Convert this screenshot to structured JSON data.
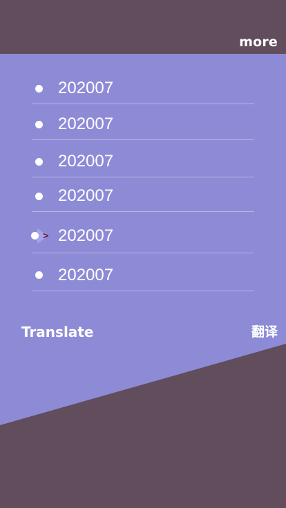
{
  "header": {
    "more_label": "more"
  },
  "list": {
    "items": [
      {
        "label": "202007",
        "active": false
      },
      {
        "label": "202007",
        "active": false
      },
      {
        "label": "202007",
        "active": false
      },
      {
        "label": "202007",
        "active": false
      },
      {
        "label": "202007",
        "active": true,
        "marker": ">"
      },
      {
        "label": "202007",
        "active": false
      }
    ]
  },
  "footer": {
    "translate_label": "Translate",
    "translate_cn_label": "翻译"
  },
  "colors": {
    "background": "#614d5c",
    "panel": "#8e8bd6",
    "text": "#ffffff",
    "divider": "#b7b5e6",
    "active_marker": "#7a1430"
  }
}
